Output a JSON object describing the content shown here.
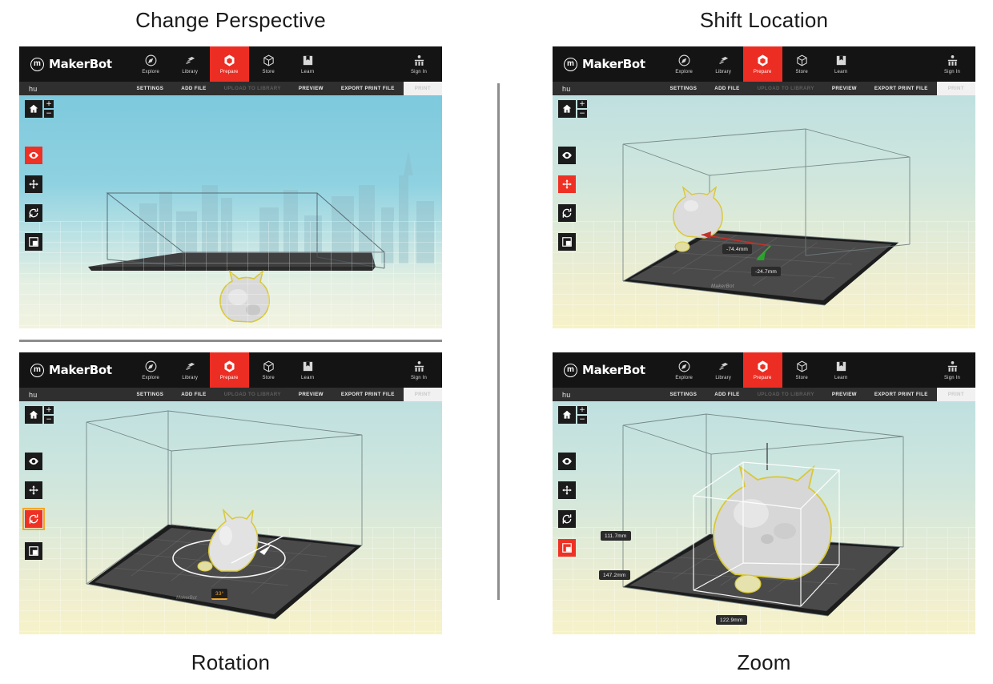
{
  "figure": {
    "captions": {
      "top_left": "Change Perspective",
      "top_right": "Shift Location",
      "bottom_left": "Rotation",
      "bottom_right": "Zoom"
    }
  },
  "app": {
    "brand": "MakerBot",
    "brand_mark": "m",
    "nav": [
      {
        "label": "Explore",
        "icon": "compass-icon",
        "active": false
      },
      {
        "label": "Library",
        "icon": "books-icon",
        "active": false
      },
      {
        "label": "Prepare",
        "icon": "hexagon-icon",
        "active": true
      },
      {
        "label": "Store",
        "icon": "box-icon",
        "active": false
      },
      {
        "label": "Learn",
        "icon": "book-icon",
        "active": false
      }
    ],
    "signin": {
      "label": "Sign In",
      "icon": "person-icon"
    },
    "subbar": {
      "tab": "hu",
      "actions": [
        {
          "label": "SETTINGS",
          "state": "enabled"
        },
        {
          "label": "ADD FILE",
          "state": "enabled"
        },
        {
          "label": "UPLOAD TO LIBRARY",
          "state": "disabled"
        },
        {
          "label": "PREVIEW",
          "state": "enabled"
        },
        {
          "label": "EXPORT PRINT FILE",
          "state": "enabled"
        },
        {
          "label": "PRINT",
          "state": "print"
        }
      ]
    },
    "tools": [
      {
        "name": "home",
        "icon": "home-icon"
      },
      {
        "name": "view",
        "icon": "eye-icon"
      },
      {
        "name": "move",
        "icon": "move-arrows-icon"
      },
      {
        "name": "rotate",
        "icon": "rotate-icon"
      },
      {
        "name": "scale",
        "icon": "scale-icon"
      }
    ],
    "zoom_buttons": {
      "plus": "+",
      "minus": "−"
    },
    "plate_logo": "MakerBot"
  },
  "panels": {
    "change_perspective": {
      "active_tool": "view",
      "measurements": []
    },
    "shift_location": {
      "active_tool": "move",
      "measurements": [
        {
          "label": "-74.4mm",
          "axis": "x"
        },
        {
          "label": "-24.7mm",
          "axis": "y"
        }
      ]
    },
    "rotation": {
      "active_tool": "rotate",
      "measurements": [
        {
          "label": "33°",
          "axis": "z"
        }
      ]
    },
    "zoom": {
      "active_tool": "scale",
      "measurements": [
        {
          "label": "111.7mm",
          "axis": "z"
        },
        {
          "label": "147.2mm",
          "axis": "y"
        },
        {
          "label": "122.9mm",
          "axis": "x"
        }
      ]
    }
  },
  "colors": {
    "accent_red": "#ee3124",
    "nav_bg": "#141414",
    "subbar_bg": "#2f2f2f",
    "selection_outline": "#f5a623",
    "model_outline": "#d8c838",
    "divider": "#8d8d8d"
  }
}
